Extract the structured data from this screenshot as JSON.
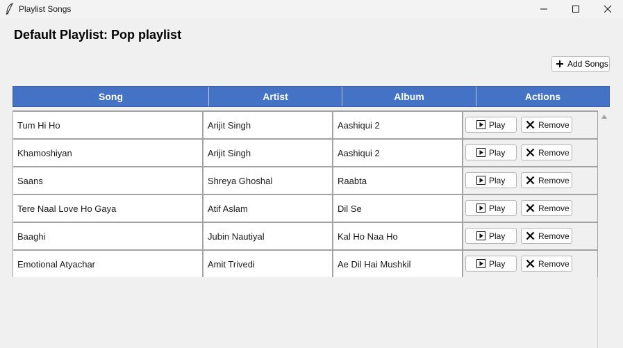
{
  "window": {
    "title": "Playlist Songs",
    "controls": [
      "minimize-icon",
      "maximize-icon",
      "close-icon"
    ]
  },
  "heading": "Default Playlist: Pop playlist",
  "add_songs_label": "Add Songs",
  "columns": [
    "Song",
    "Artist",
    "Album",
    "Actions"
  ],
  "rows": [
    {
      "song": "Tum Hi Ho",
      "artist": "Arijit Singh",
      "album": "Aashiqui 2"
    },
    {
      "song": "Khamoshiyan",
      "artist": "Arijit Singh",
      "album": "Aashiqui 2"
    },
    {
      "song": "Saans",
      "artist": "Shreya Ghoshal",
      "album": "Raabta"
    },
    {
      "song": "Tere Naal Love Ho Gaya",
      "artist": "Atif Aslam",
      "album": "Dil Se"
    },
    {
      "song": "Baaghi",
      "artist": "Jubin Nautiyal",
      "album": "Kal Ho Naa Ho"
    },
    {
      "song": "Emotional Atyachar",
      "artist": "Amit Trivedi",
      "album": "Ae Dil Hai Mushkil"
    }
  ],
  "actions": {
    "play": "Play",
    "remove": "Remove"
  },
  "colors": {
    "header_bg": "#4472c4",
    "header_text": "#ffffff"
  }
}
